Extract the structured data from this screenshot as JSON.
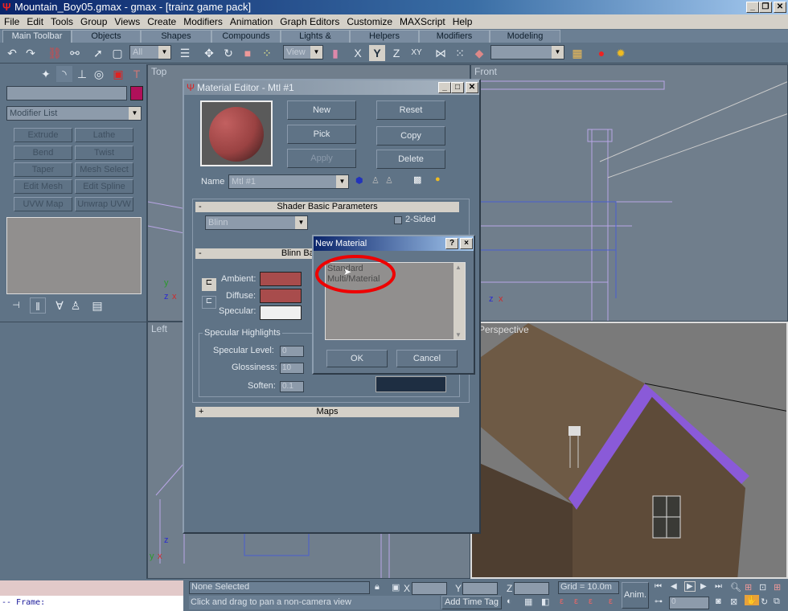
{
  "window": {
    "title": "Mountain_Boy05.gmax - gmax - [trainz game pack]"
  },
  "menu": [
    "File",
    "Edit",
    "Tools",
    "Group",
    "Views",
    "Create",
    "Modifiers",
    "Animation",
    "Graph Editors",
    "Customize",
    "MAXScript",
    "Help"
  ],
  "tabs": [
    "Main Toolbar",
    "Objects",
    "Shapes",
    "Compounds",
    "Lights & Cameras",
    "Helpers",
    "Modifiers",
    "Modeling"
  ],
  "toolbar": {
    "selection_filter": "All",
    "ref_coord": "View",
    "named_selection": ""
  },
  "command_panel": {
    "object_name": "",
    "object_color": "#b0105a",
    "modifier_list": "Modifier List",
    "modifier_buttons": [
      "Extrude",
      "Lathe",
      "Bend",
      "Twist",
      "Taper",
      "Mesh Select",
      "Edit Mesh",
      "Edit Spline",
      "UVW Map",
      "Unwrap UVW"
    ]
  },
  "viewports": {
    "top": "Top",
    "front": "Front",
    "left": "Left",
    "perspective": "Perspective"
  },
  "material_editor": {
    "title": "Material Editor - Mtl #1",
    "buttons": {
      "new": "New",
      "reset": "Reset",
      "pick": "Pick",
      "copy": "Copy",
      "apply": "Apply",
      "delete": "Delete"
    },
    "name_label": "Name",
    "name_value": "Mtl #1",
    "shader_rollout": "Shader Basic Parameters",
    "shader": "Blinn",
    "two_sided": "2-Sided",
    "two_sided_checked": false,
    "blinn_rollout": "Blinn Basic Parameters",
    "ambient": "Ambient:",
    "diffuse": "Diffuse:",
    "specular": "Specular:",
    "ambient_color": "#a84c4c",
    "diffuse_color": "#a84c4c",
    "specular_color": "#f0f0f0",
    "highlights": "Specular Highlights",
    "spec_level_label": "Specular Level:",
    "spec_level": "0",
    "glossiness_label": "Glossiness:",
    "glossiness": "10",
    "soften_label": "Soften:",
    "soften": "0.1",
    "maps_rollout": "Maps",
    "collapse": "-",
    "expand": "+"
  },
  "new_material": {
    "title": "New Material",
    "help": "?",
    "close": "×",
    "items": [
      "Standard",
      "Multi/Material"
    ],
    "ok": "OK",
    "cancel": "Cancel"
  },
  "status": {
    "listener": "-- Frame:",
    "selection": "None Selected",
    "prompt": "Click and drag to pan a non-camera view",
    "x_label": "X",
    "y_label": "Y",
    "z_label": "Z",
    "x": "",
    "y": "",
    "z": "",
    "grid": "Grid = 10.0m",
    "add_time_tag": "Add Time Tag",
    "anim": "Anim.",
    "frame": "0"
  },
  "axes": {
    "x": "x",
    "y": "y",
    "z": "z"
  }
}
